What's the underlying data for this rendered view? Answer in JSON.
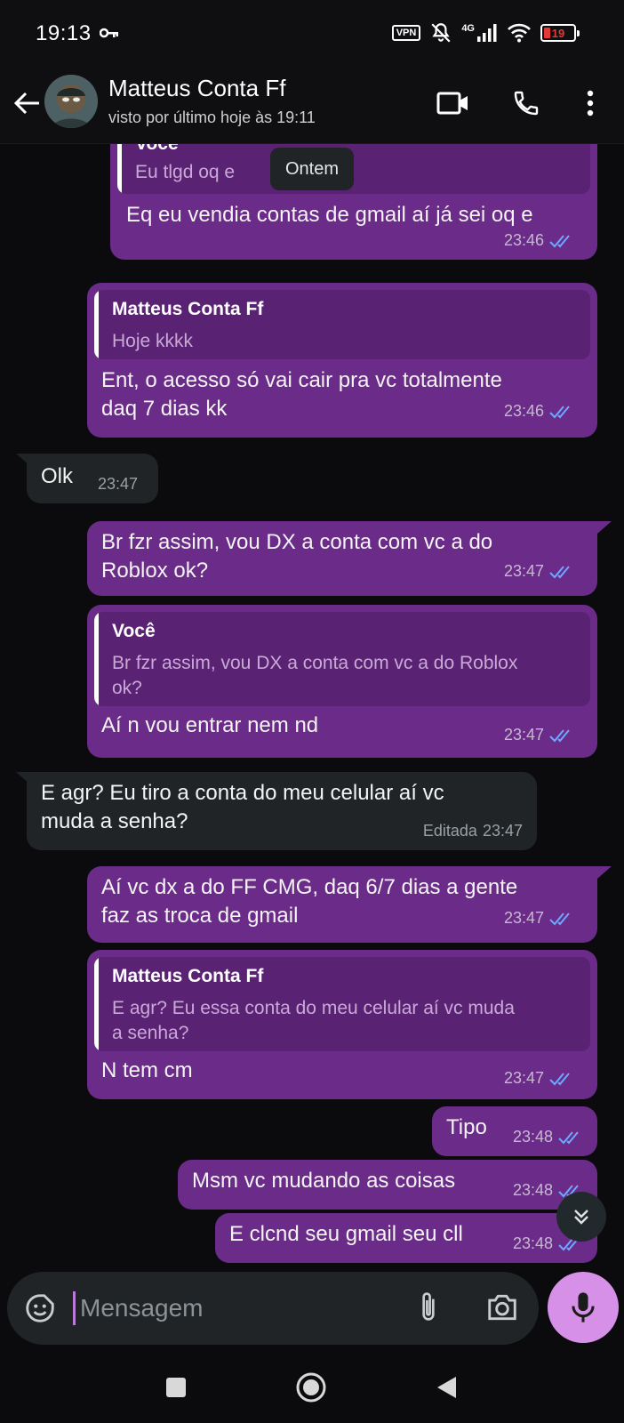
{
  "status_bar": {
    "time": "19:13",
    "vpn_label": "VPN",
    "network": "4G",
    "battery": "19"
  },
  "header": {
    "contact_name": "Matteus Conta Ff",
    "last_seen": "visto por último hoje às 19:11"
  },
  "date_pill": "Ontem",
  "messages": [
    {
      "type": "outgoing",
      "quote_author": "Você",
      "quote_text": "Eu tlgd oq e",
      "text": "Eq eu vendia contas de gmail aí já sei oq e",
      "time": "23:46"
    },
    {
      "type": "outgoing",
      "quote_author": "Matteus Conta Ff",
      "quote_text": "Hoje kkkk",
      "text": "Ent, o acesso só vai cair pra vc totalmente\ndaq 7 dias kk",
      "time": "23:46"
    },
    {
      "type": "incoming",
      "text": "Olk",
      "time": "23:47"
    },
    {
      "type": "outgoing",
      "text": "Br fzr assim, vou DX a conta com vc a do\nRoblox ok?",
      "time": "23:47"
    },
    {
      "type": "outgoing",
      "quote_author": "Você",
      "quote_text": "Br fzr assim, vou DX a conta com vc a do Roblox\nok?",
      "text": "Aí n vou entrar nem nd",
      "time": "23:47"
    },
    {
      "type": "incoming",
      "text": "E agr? Eu tiro a conta do meu celular aí vc\nmuda a senha?",
      "edited_label": "Editada",
      "time": "23:47"
    },
    {
      "type": "outgoing",
      "text": "Aí vc dx a do FF CMG, daq 6/7 dias a gente\nfaz as troca de gmail",
      "time": "23:47"
    },
    {
      "type": "outgoing",
      "quote_author": "Matteus Conta Ff",
      "quote_text": "E agr? Eu essa conta do meu celular aí vc muda\na senha?",
      "text": "N tem cm",
      "time": "23:47"
    },
    {
      "type": "outgoing",
      "text": "Tipo",
      "time": "23:48"
    },
    {
      "type": "outgoing",
      "text": "Msm vc mudando as coisas",
      "time": "23:48"
    },
    {
      "type": "outgoing",
      "text": "E clcnd seu gmail seu cll",
      "time": "23:48"
    }
  ],
  "composer": {
    "placeholder": "Mensagem"
  },
  "colors": {
    "outgoing_bubble": "#6b2b88",
    "incoming_bubble": "#202426",
    "read_ticks": "#6fa8ff",
    "mic_button": "#d790e8"
  },
  "icons": {
    "back": "arrow-left-icon",
    "video": "video-camera-icon",
    "call": "phone-icon",
    "menu": "more-vertical-icon",
    "emoji": "sticker-emoji-icon",
    "attach": "paperclip-icon",
    "camera": "camera-icon",
    "mic": "microphone-icon",
    "scroll": "double-chevron-down-icon"
  }
}
